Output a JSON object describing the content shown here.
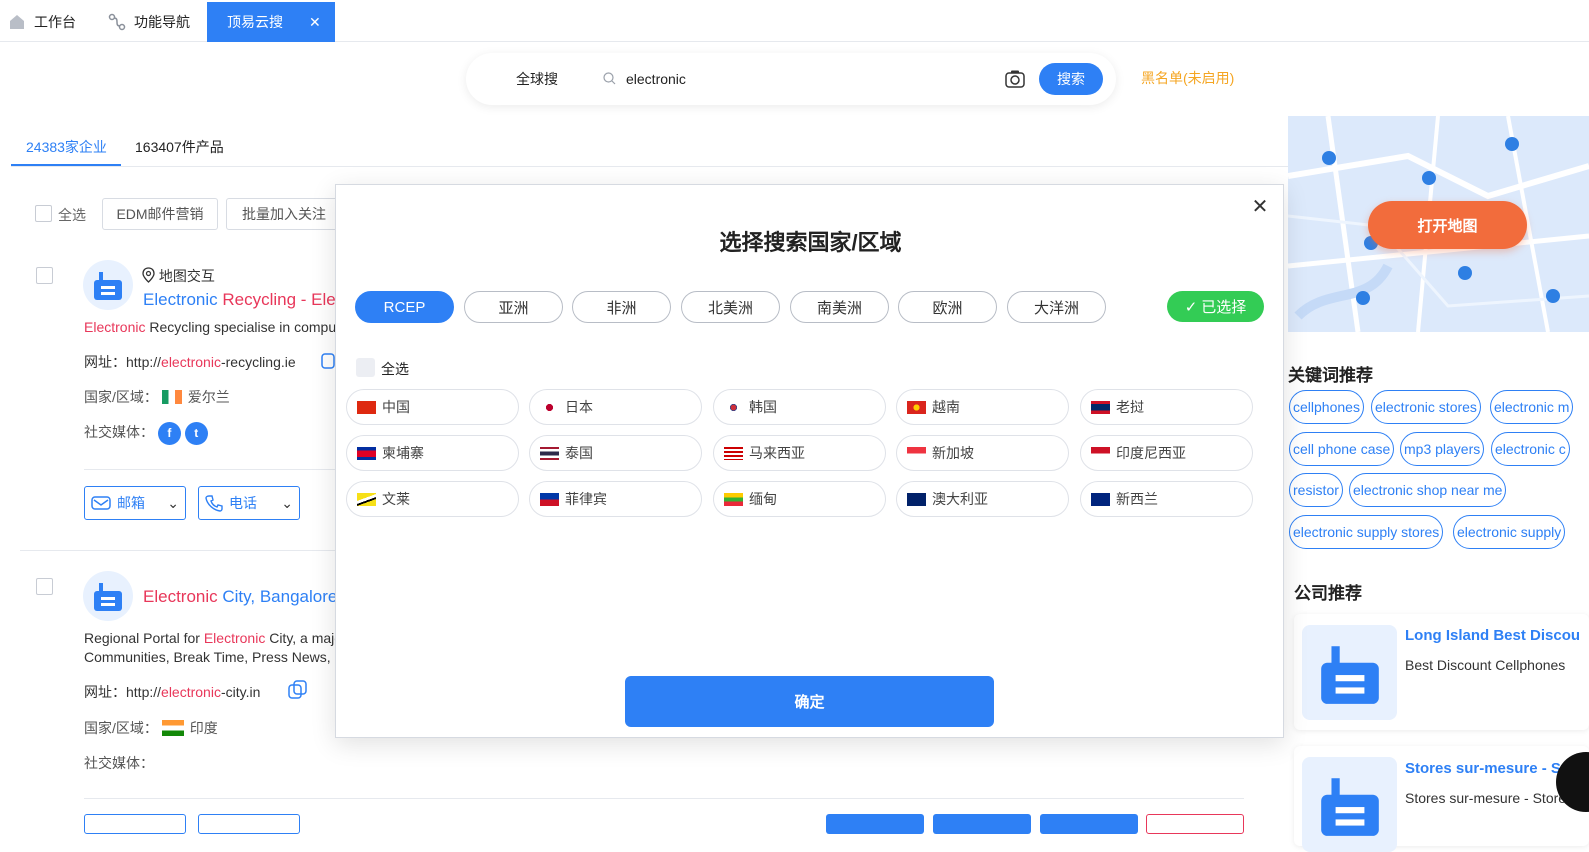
{
  "tabs": [
    {
      "label": "工作台"
    },
    {
      "label": "功能导航"
    },
    {
      "label": "顶易云搜"
    }
  ],
  "search": {
    "scope": "全球搜",
    "query": "electronic",
    "button": "搜索",
    "blacklist": "黑名单(未启用)"
  },
  "result_tabs": [
    "24383家企业",
    "163407件产品"
  ],
  "toolbar": {
    "select_all": "全选",
    "edm": "EDM邮件营销",
    "follow": "批量加入关注"
  },
  "cards": [
    {
      "map_link": "地图交互",
      "title_hl": "Electronic",
      "title_rest": " Recycling - Elec",
      "desc_hl": "Electronic",
      "desc_rest": " Recycling specialise in compute",
      "url_label": "网址：",
      "url_pre": "http://",
      "url_hl": "electronic",
      "url_post": "-recycling.ie",
      "country_label": "国家/区域：",
      "country": "爱尔兰",
      "social_label": "社交媒体：",
      "mail_btn": "邮箱",
      "phone_btn": "电话"
    },
    {
      "title_hl": "Electronic",
      "title_rest": " City, Bangalore -",
      "desc1_pre": "Regional Portal for ",
      "desc1_hl": "Electronic",
      "desc1_post": " City, a major",
      "desc2": "Communities, Break Time, Press News, Ne",
      "url_label": "网址：",
      "url_pre": "http://",
      "url_hl": "electronic",
      "url_post": "-city.in",
      "country_label": "国家/区域：",
      "country": "印度",
      "social_label": "社交媒体："
    }
  ],
  "right_panel": {
    "map_button": "打开地图",
    "keywords_title": "关键词推荐",
    "keywords": [
      "cellphones",
      "electronic stores",
      "electronic m",
      "cell phone case",
      "mp3 players",
      "electronic c",
      "resistor",
      "electronic shop near me",
      "electronic supply stores",
      "electronic supply"
    ],
    "companies_title": "公司推荐",
    "companies": [
      {
        "title": "Long Island Best Discou",
        "desc": "Best Discount Cellphones"
      },
      {
        "title": "Stores sur-mesure - St",
        "desc": "Stores sur-mesure - Store"
      }
    ]
  },
  "modal": {
    "title": "选择搜索国家/区域",
    "regions": [
      "RCEP",
      "亚洲",
      "非洲",
      "北美洲",
      "南美洲",
      "欧洲",
      "大洋洲"
    ],
    "active_region": "RCEP",
    "selected_label": "已选择",
    "select_all": "全选",
    "countries": [
      "中国",
      "日本",
      "韩国",
      "越南",
      "老挝",
      "柬埔寨",
      "泰国",
      "马来西亚",
      "新加坡",
      "印度尼西亚",
      "文莱",
      "菲律宾",
      "缅甸",
      "澳大利亚",
      "新西兰"
    ],
    "confirm": "确定"
  },
  "colors": {
    "primary": "#2e80f5",
    "highlight": "#e8375a",
    "success": "#33cc55",
    "map_button": "#f26c3c",
    "warning": "#f5a623"
  }
}
